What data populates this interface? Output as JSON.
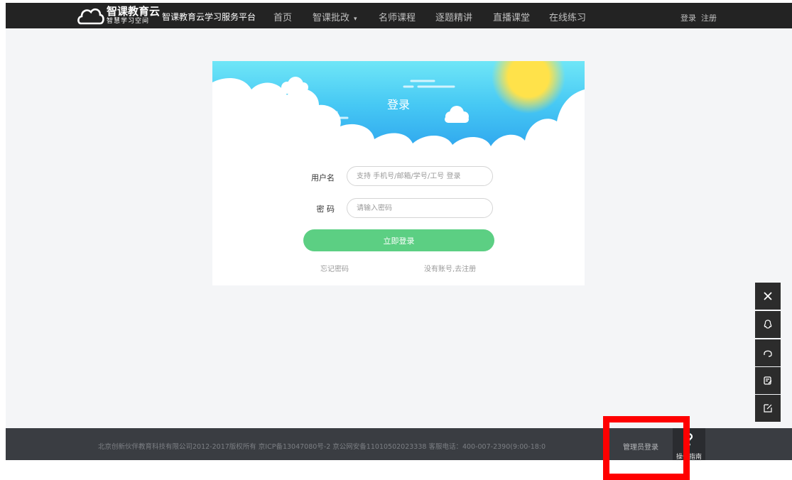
{
  "header": {
    "logo_main": "智课教育云",
    "logo_sub": "智慧学习空间",
    "platform_name": "智课教育云学习服务平台",
    "nav": [
      {
        "label": "首页"
      },
      {
        "label": "智课批改"
      },
      {
        "label": "名师课程"
      },
      {
        "label": "逐题精讲"
      },
      {
        "label": "直播课堂"
      },
      {
        "label": "在线练习"
      }
    ],
    "login_link": "登录",
    "register_link": "注册"
  },
  "login": {
    "title": "登录",
    "username_label": "用户名",
    "username_placeholder": "支持 手机号/邮箱/学号/工号 登录",
    "password_label": "密 码",
    "password_placeholder": "请输入密码",
    "submit_label": "立即登录",
    "forgot_link": "忘记密码",
    "register_link": "没有账号,去注册"
  },
  "side_toolbar": [
    "close-icon",
    "qq-icon",
    "headset-icon",
    "feedback-icon",
    "edit-icon"
  ],
  "footer": {
    "copyright": "北京创新伙伴教育科技有限公司2012-2017版权所有   京ICP备13047080号-2   京公网安备11010502023338   客服电话：400-007-2390(9:00-18:0",
    "admin_login": "管理员登录",
    "guide_label": "操作指南"
  },
  "colors": {
    "nav_bg": "#232323",
    "footer_bg": "#3a3d42",
    "accent_green": "#5ccf83",
    "sky_blue": "#3fb9f5",
    "sun_yellow": "#ffe24a",
    "highlight_red": "#ff0000"
  }
}
